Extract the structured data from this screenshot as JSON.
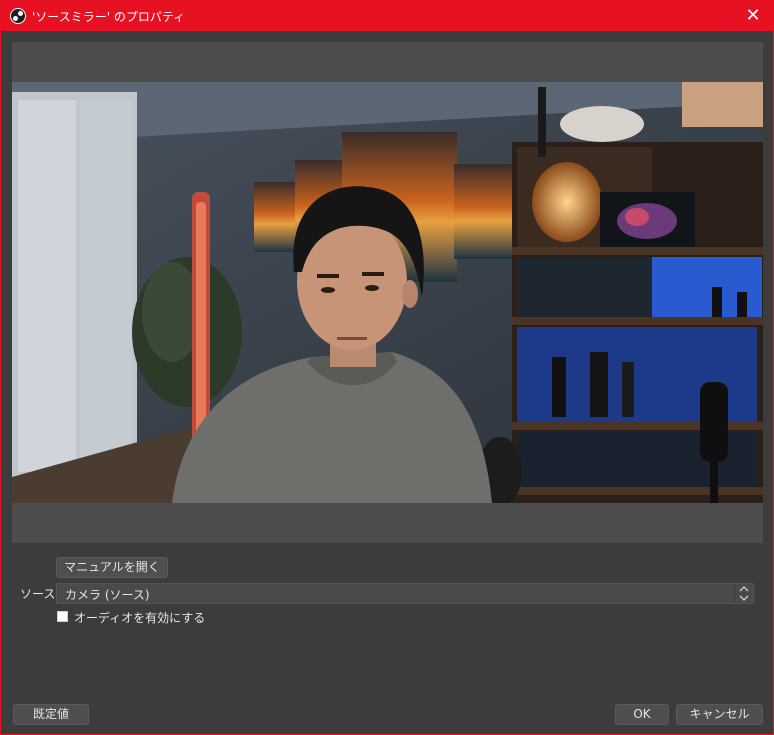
{
  "window": {
    "title": "'ソースミラー' のプロパティ",
    "close_glyph": "✕",
    "accent_color": "#e81123"
  },
  "icons": {
    "app": "obs-logo-icon",
    "close": "close-icon",
    "spin": "up-down-arrows-icon"
  },
  "preview": {
    "content": "camera feed"
  },
  "form": {
    "manual_button": "マニュアルを開く",
    "source_label": "ソース",
    "source_value": "カメラ (ソース)",
    "audio_checkbox_label": "オーディオを有効にする",
    "audio_checked": false
  },
  "footer": {
    "defaults_button": "既定値",
    "ok_button": "OK",
    "cancel_button": "キャンセル"
  }
}
